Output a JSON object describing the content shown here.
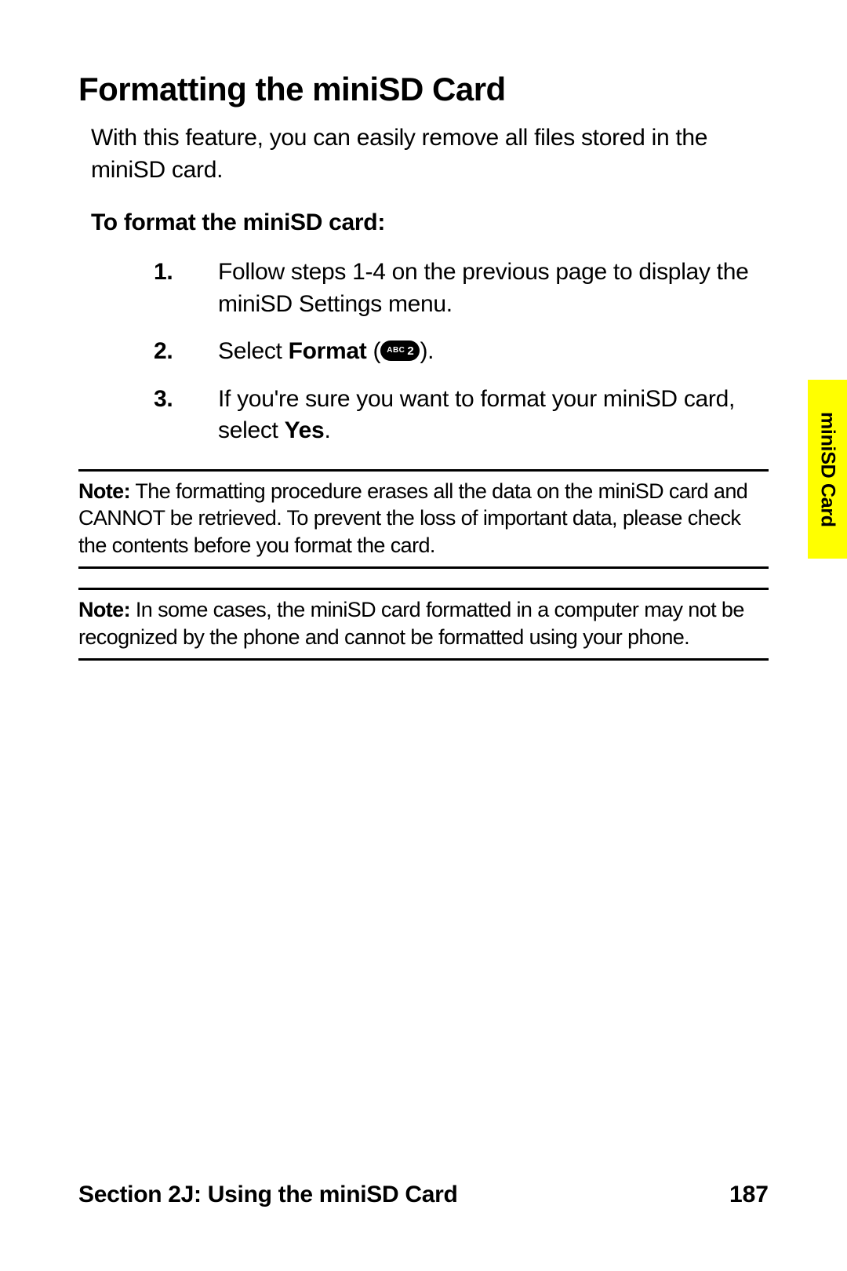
{
  "title": "Formatting the miniSD Card",
  "intro": "With this feature, you can easily remove all files stored in the miniSD card.",
  "subhead": "To format the miniSD card:",
  "steps": {
    "s1": "Follow steps 1-4 on the previous page to display the miniSD Settings menu.",
    "s2_prefix": "Select ",
    "s2_bold": "Format",
    "s2_open": " (",
    "s2_close": ").",
    "key_abc": "ABC",
    "key_num": "2",
    "s3_prefix": "If you're sure you want to format your miniSD card, select ",
    "s3_bold": "Yes",
    "s3_suffix": "."
  },
  "notes": {
    "label": "Note:",
    "n1": " The formatting procedure erases all the data on the miniSD card and CANNOT be retrieved. To prevent the loss of important data, please check the contents before you format the card.",
    "n2": " In some cases, the miniSD card formatted in a computer may not be recognized by the phone and cannot be formatted using your phone."
  },
  "side_tab": "miniSD Card",
  "footer": {
    "section": "Section 2J: Using the miniSD Card",
    "page": "187"
  }
}
